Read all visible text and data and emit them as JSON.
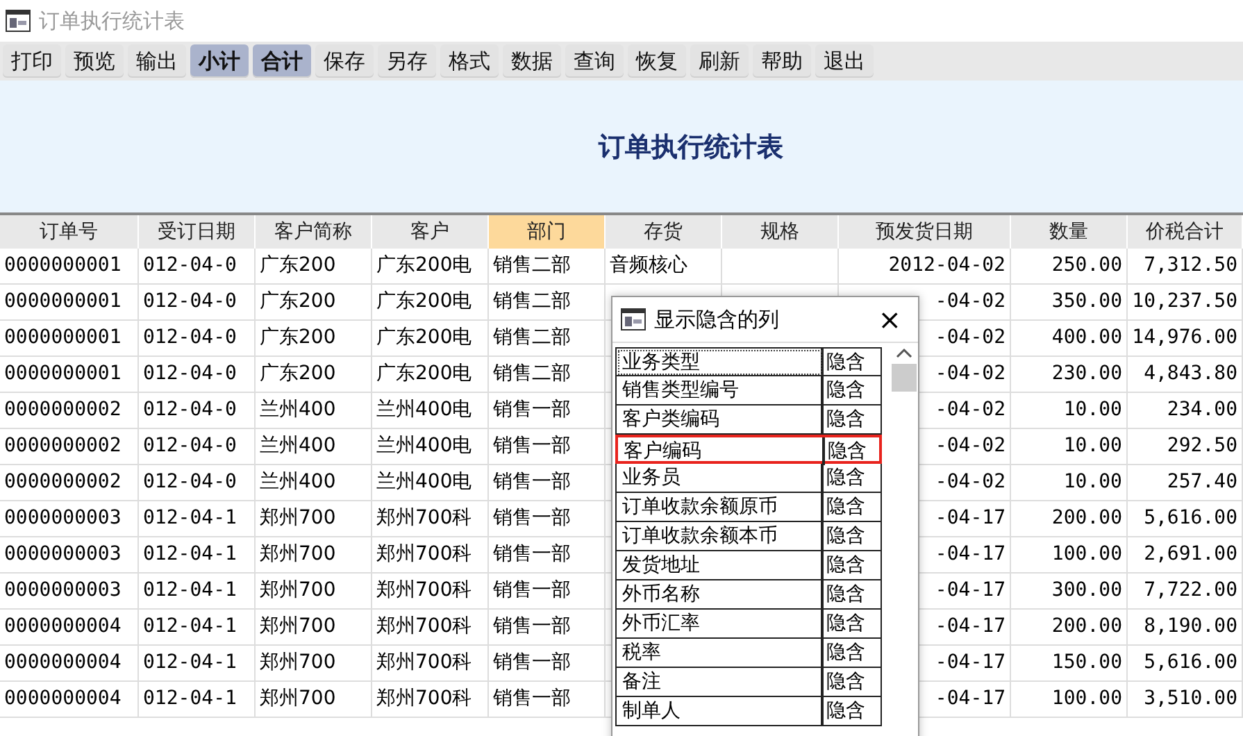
{
  "window": {
    "title": "订单执行统计表"
  },
  "toolbar": [
    {
      "label": "打印",
      "selected": false
    },
    {
      "label": "预览",
      "selected": false
    },
    {
      "label": "输出",
      "selected": false
    },
    {
      "label": "小计",
      "selected": true
    },
    {
      "label": "合计",
      "selected": true
    },
    {
      "label": "保存",
      "selected": false
    },
    {
      "label": "另存",
      "selected": false
    },
    {
      "label": "格式",
      "selected": false
    },
    {
      "label": "数据",
      "selected": false
    },
    {
      "label": "查询",
      "selected": false
    },
    {
      "label": "恢复",
      "selected": false
    },
    {
      "label": "刷新",
      "selected": false
    },
    {
      "label": "帮助",
      "selected": false
    },
    {
      "label": "退出",
      "selected": false
    }
  ],
  "report_title": "订单执行统计表",
  "table": {
    "columns": [
      {
        "label": "订单号",
        "selected": false
      },
      {
        "label": "受订日期",
        "selected": false
      },
      {
        "label": "客户简称",
        "selected": false
      },
      {
        "label": "客户",
        "selected": false
      },
      {
        "label": "部门",
        "selected": true
      },
      {
        "label": "存货",
        "selected": false
      },
      {
        "label": "规格",
        "selected": false
      },
      {
        "label": "预发货日期",
        "selected": false
      },
      {
        "label": "数量",
        "selected": false
      },
      {
        "label": "价税合计",
        "selected": false
      }
    ],
    "rows": [
      {
        "order": "0000000001",
        "date": "012-04-0",
        "short": "广东200",
        "customer": "广东200电",
        "dept": "销售二部",
        "stock": "音频核心",
        "ship": "2012-04-02",
        "qty": "250.00",
        "total": "7,312.50"
      },
      {
        "order": "0000000001",
        "date": "012-04-0",
        "short": "广东200",
        "customer": "广东200电",
        "dept": "销售二部",
        "ship": "-04-02",
        "qty": "350.00",
        "total": "10,237.50"
      },
      {
        "order": "0000000001",
        "date": "012-04-0",
        "short": "广东200",
        "customer": "广东200电",
        "dept": "销售二部",
        "ship": "-04-02",
        "qty": "400.00",
        "total": "14,976.00"
      },
      {
        "order": "0000000001",
        "date": "012-04-0",
        "short": "广东200",
        "customer": "广东200电",
        "dept": "销售二部",
        "ship": "-04-02",
        "qty": "230.00",
        "total": "4,843.80"
      },
      {
        "order": "0000000002",
        "date": "012-04-0",
        "short": "兰州400",
        "customer": "兰州400电",
        "dept": "销售一部",
        "ship": "-04-02",
        "qty": "10.00",
        "total": "234.00"
      },
      {
        "order": "0000000002",
        "date": "012-04-0",
        "short": "兰州400",
        "customer": "兰州400电",
        "dept": "销售一部",
        "ship": "-04-02",
        "qty": "10.00",
        "total": "292.50"
      },
      {
        "order": "0000000002",
        "date": "012-04-0",
        "short": "兰州400",
        "customer": "兰州400电",
        "dept": "销售一部",
        "ship": "-04-02",
        "qty": "10.00",
        "total": "257.40"
      },
      {
        "order": "0000000003",
        "date": "012-04-1",
        "short": "郑州700",
        "customer": "郑州700科",
        "dept": "销售一部",
        "ship": "-04-17",
        "qty": "200.00",
        "total": "5,616.00"
      },
      {
        "order": "0000000003",
        "date": "012-04-1",
        "short": "郑州700",
        "customer": "郑州700科",
        "dept": "销售一部",
        "ship": "-04-17",
        "qty": "100.00",
        "total": "2,691.00"
      },
      {
        "order": "0000000003",
        "date": "012-04-1",
        "short": "郑州700",
        "customer": "郑州700科",
        "dept": "销售一部",
        "ship": "-04-17",
        "qty": "300.00",
        "total": "7,722.00"
      },
      {
        "order": "0000000004",
        "date": "012-04-1",
        "short": "郑州700",
        "customer": "郑州700科",
        "dept": "销售一部",
        "ship": "-04-17",
        "qty": "200.00",
        "total": "8,190.00"
      },
      {
        "order": "0000000004",
        "date": "012-04-1",
        "short": "郑州700",
        "customer": "郑州700科",
        "dept": "销售一部",
        "ship": "-04-17",
        "qty": "150.00",
        "total": "5,616.00"
      },
      {
        "order": "0000000004",
        "date": "012-04-1",
        "short": "郑州700",
        "customer": "郑州700科",
        "dept": "销售一部",
        "ship": "-04-17",
        "qty": "100.00",
        "total": "3,510.00"
      }
    ]
  },
  "dialog": {
    "title": "显示隐含的列",
    "close": "×",
    "items": [
      {
        "name": "业务类型",
        "status": "隐含",
        "selected": false,
        "focused": true
      },
      {
        "name": "销售类型编号",
        "status": "隐含",
        "selected": false,
        "focused": false
      },
      {
        "name": "客户类编码",
        "status": "隐含",
        "selected": false,
        "focused": false
      },
      {
        "name": "客户编码",
        "status": "隐含",
        "selected": true,
        "focused": false
      },
      {
        "name": "业务员",
        "status": "隐含",
        "selected": false,
        "focused": false
      },
      {
        "name": "订单收款余额原币",
        "status": "隐含",
        "selected": false,
        "focused": false
      },
      {
        "name": "订单收款余额本币",
        "status": "隐含",
        "selected": false,
        "focused": false
      },
      {
        "name": "发货地址",
        "status": "隐含",
        "selected": false,
        "focused": false
      },
      {
        "name": "外币名称",
        "status": "隐含",
        "selected": false,
        "focused": false
      },
      {
        "name": "外币汇率",
        "status": "隐含",
        "selected": false,
        "focused": false
      },
      {
        "name": "税率",
        "status": "隐含",
        "selected": false,
        "focused": false
      },
      {
        "name": "备注",
        "status": "隐含",
        "selected": false,
        "focused": false
      },
      {
        "name": "制单人",
        "status": "隐含",
        "selected": false,
        "focused": false
      }
    ]
  }
}
